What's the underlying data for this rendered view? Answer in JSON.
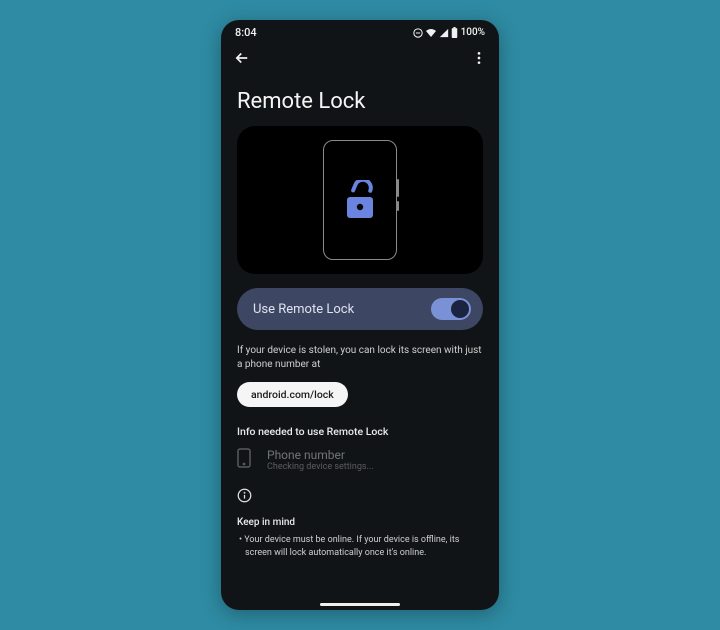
{
  "status": {
    "time": "8:04",
    "battery": "100%"
  },
  "page": {
    "title": "Remote Lock"
  },
  "toggle": {
    "label": "Use Remote Lock",
    "on": true
  },
  "description": "If your device is stolen, you can lock its screen with just a phone number at",
  "url_chip": "android.com/lock",
  "section_info_label": "Info needed to use Remote Lock",
  "phone_number": {
    "title": "Phone number",
    "subtitle": "Checking device settings..."
  },
  "keep_in_mind": {
    "label": "Keep in mind",
    "bullet1": "Your device must be online. If your device is offline, its screen will lock automatically once it's online."
  }
}
